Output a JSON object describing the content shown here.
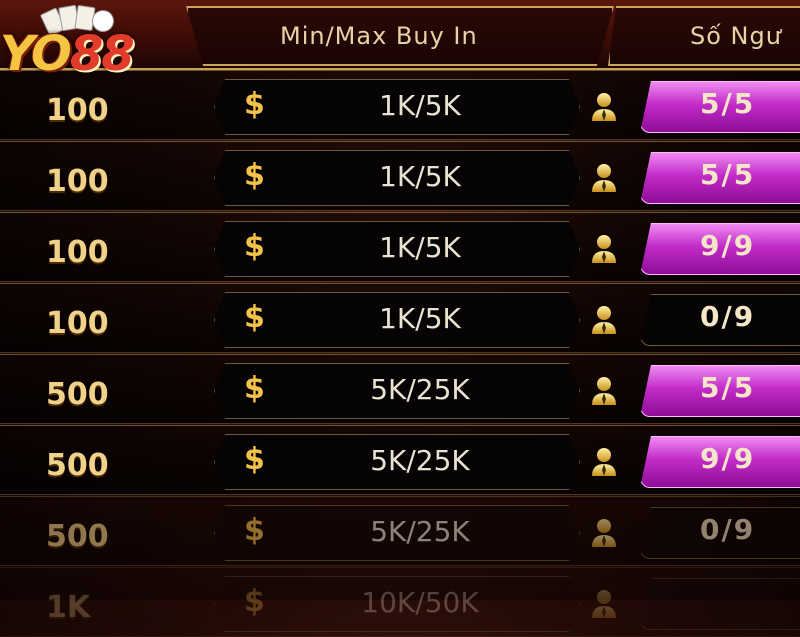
{
  "header": {
    "buy_in_label": "Min/Max Buy In",
    "players_label": "Số Ngư"
  },
  "logo": {
    "text_a": "YO",
    "text_b": "88"
  },
  "rows": [
    {
      "bet": "100",
      "currency": "$",
      "buy_in": "1K/5K",
      "seats": "5/5",
      "full": true
    },
    {
      "bet": "100",
      "currency": "$",
      "buy_in": "1K/5K",
      "seats": "5/5",
      "full": true
    },
    {
      "bet": "100",
      "currency": "$",
      "buy_in": "1K/5K",
      "seats": "9/9",
      "full": true
    },
    {
      "bet": "100",
      "currency": "$",
      "buy_in": "1K/5K",
      "seats": "0/9",
      "full": false
    },
    {
      "bet": "500",
      "currency": "$",
      "buy_in": "5K/25K",
      "seats": "5/5",
      "full": true
    },
    {
      "bet": "500",
      "currency": "$",
      "buy_in": "5K/25K",
      "seats": "9/9",
      "full": true
    },
    {
      "bet": "500",
      "currency": "$",
      "buy_in": "5K/25K",
      "seats": "0/9",
      "full": false
    },
    {
      "bet": "1K",
      "currency": "$",
      "buy_in": "10K/50K",
      "seats": "",
      "full": false
    }
  ],
  "icons": {
    "player": "person-icon",
    "currency": "dollar-icon"
  },
  "colors": {
    "gold": "#f1d28a",
    "magenta": "#c22bc8",
    "header_border": "#c9a45a"
  }
}
